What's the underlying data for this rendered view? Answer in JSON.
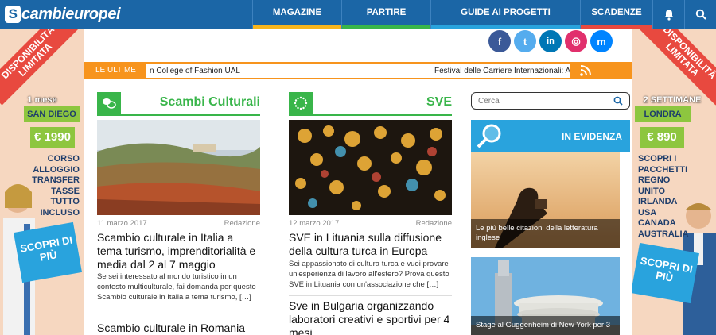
{
  "header": {
    "logo_text": "cambieuropei",
    "logo_mark": "S",
    "nav": [
      {
        "label": "MAGAZINE",
        "bar_color": "#f7b51d"
      },
      {
        "label": "PARTIRE",
        "bar_color": "#39b54a"
      },
      {
        "label": "GUIDE AI PROGETTI",
        "bar_color": "#29a3dd"
      },
      {
        "label": "SCADENZE",
        "bar_color": "#e8493f"
      }
    ],
    "icons": [
      "bell-icon",
      "search-icon"
    ]
  },
  "social": [
    {
      "name": "facebook-icon",
      "glyph": "f",
      "color": "#3b5998"
    },
    {
      "name": "twitter-icon",
      "glyph": "t",
      "color": "#55acee"
    },
    {
      "name": "linkedin-icon",
      "glyph": "in",
      "color": "#0077b5"
    },
    {
      "name": "instagram-icon",
      "glyph": "◎",
      "color": "#e1306c"
    },
    {
      "name": "messenger-icon",
      "glyph": "m",
      "color": "#0084ff"
    }
  ],
  "ticker": {
    "label": "LE ULTIME",
    "item1": "n College of Fashion UAL",
    "item2": "Festival delle Carriere Internazionali: A"
  },
  "left_banner": {
    "ribbon": "DISPONIBILITÀ LIMITATA",
    "duration": "1 mese",
    "city": "SAN DIEGO",
    "price": "€ 1990",
    "features": [
      "CORSO",
      "ALLOGGIO",
      "TRANSFER",
      "TASSE",
      "TUTTO",
      "INCLUSO"
    ],
    "cta": "SCOPRI DI PIÙ"
  },
  "right_banner": {
    "ribbon": "DISPONIBILITÀ LIMITATA",
    "duration": "2 SETTIMANE",
    "city": "LONDRA",
    "price": "€ 890",
    "features": [
      "SCOPRI I",
      "PACCHETTI",
      "REGNO",
      "UNITO",
      "IRLANDA",
      "USA",
      "CANADA",
      "AUSTRALIA"
    ],
    "cta": "SCOPRI DI PIÙ"
  },
  "columns": [
    {
      "title": "Scambi Culturali",
      "icon": "chat-bubbles-icon",
      "date": "11 marzo 2017",
      "author": "Redazione",
      "article_title": "Scambio culturale in Italia a tema turismo, imprenditorialità e media dal 2 al 7 maggio",
      "excerpt": "Se sei interessato al mondo turistico in un contesto multiculturale, fai domanda per questo Scambio culturale in Italia a tema turismo, […]",
      "next_title": "Scambio culturale in Romania"
    },
    {
      "title": "SVE",
      "icon": "eu-stars-icon",
      "date": "12 marzo 2017",
      "author": "Redazione",
      "article_title": "SVE in Lituania sulla diffusione della cultura turca in Europa",
      "excerpt": "Sei appassionato di cultura turca e vuoi provare un'esperienza di lavoro all'estero? Prova questo SVE in Lituania con un'associazione che […]",
      "next_title": "Sve in Bulgaria organizzando laboratori creativi e sportivi per 4 mesi"
    }
  ],
  "sidebar": {
    "search_placeholder": "Cerca",
    "evidenza_title": "IN EVIDENZA",
    "cards": [
      {
        "caption": "Le più belle citazioni della letteratura inglese"
      },
      {
        "caption": "Stage al Guggenheim di New York per 3"
      }
    ]
  }
}
